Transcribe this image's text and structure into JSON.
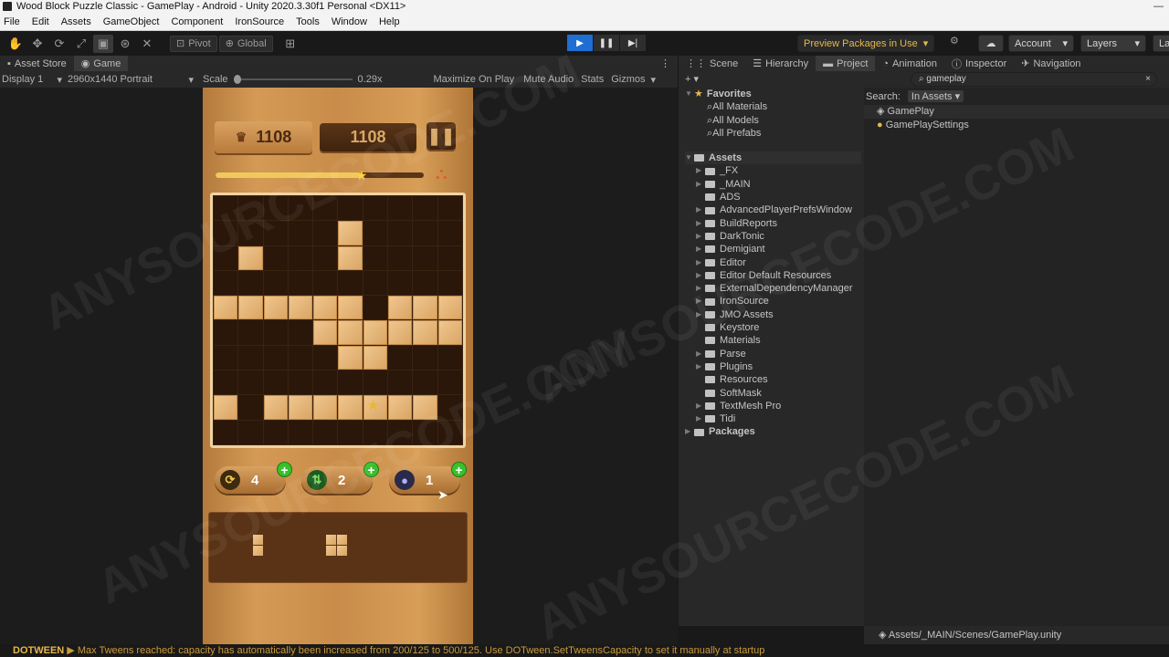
{
  "window": {
    "title": "Wood Block Puzzle Classic - GamePlay - Android - Unity 2020.3.30f1 Personal <DX11>"
  },
  "menu": [
    "File",
    "Edit",
    "Assets",
    "GameObject",
    "Component",
    "IronSource",
    "Tools",
    "Window",
    "Help"
  ],
  "toolbar": {
    "pivot": "Pivot",
    "global": "Global",
    "preview_packages": "Preview Packages in Use",
    "account": "Account",
    "layers": "Layers",
    "layout": "La"
  },
  "left_tabs": {
    "asset_store": "Asset Store",
    "game": "Game"
  },
  "game_bar": {
    "display": "Display 1",
    "resolution": "2960x1440 Portrait",
    "scale_label": "Scale",
    "scale_value": "0.29x",
    "maximize": "Maximize On Play",
    "mute": "Mute Audio",
    "stats": "Stats",
    "gizmos": "Gizmos"
  },
  "game": {
    "best_score": "1108",
    "current_score": "1108",
    "level_progress": 0.7,
    "boosters": [
      {
        "name": "rotate",
        "count": "4"
      },
      {
        "name": "swap",
        "count": "2"
      },
      {
        "name": "bomb",
        "count": "1"
      }
    ],
    "board": [
      "0000000000",
      "0000010000",
      "0100010000",
      "0000000000",
      "1111110111",
      "0000111111",
      "0000011000",
      "0000000000",
      "1011112220",
      "0000000000"
    ]
  },
  "right_tabs": {
    "scene": "Scene",
    "hierarchy": "Hierarchy",
    "project": "Project",
    "animation": "Animation",
    "inspector": "Inspector",
    "navigation": "Navigation"
  },
  "project": {
    "search_value": "gameplay",
    "search_label": "Search:",
    "search_scope": "In Assets",
    "favorites_label": "Favorites",
    "favorites": [
      "All Materials",
      "All Models",
      "All Prefabs"
    ],
    "assets_label": "Assets",
    "folders": [
      "_FX",
      "_MAIN",
      "ADS",
      "AdvancedPlayerPrefsWindow",
      "BuildReports",
      "DarkTonic",
      "Demigiant",
      "Editor",
      "Editor Default Resources",
      "ExternalDependencyManager",
      "IronSource",
      "JMO Assets",
      "Keystore",
      "Materials",
      "Parse",
      "Plugins",
      "Resources",
      "SoftMask",
      "TextMesh Pro",
      "Tidi"
    ],
    "packages_label": "Packages",
    "results": [
      "GamePlay",
      "GamePlaySettings"
    ],
    "path": "Assets/_MAIN/Scenes/GamePlay.unity"
  },
  "status": {
    "tag": "DOTWEEN",
    "message": "Max Tweens reached: capacity has automatically been increased from 200/125 to 500/125. Use DOTween.SetTweensCapacity to set it manually at startup"
  },
  "watermark": "ANYSOURCECODE.COM"
}
